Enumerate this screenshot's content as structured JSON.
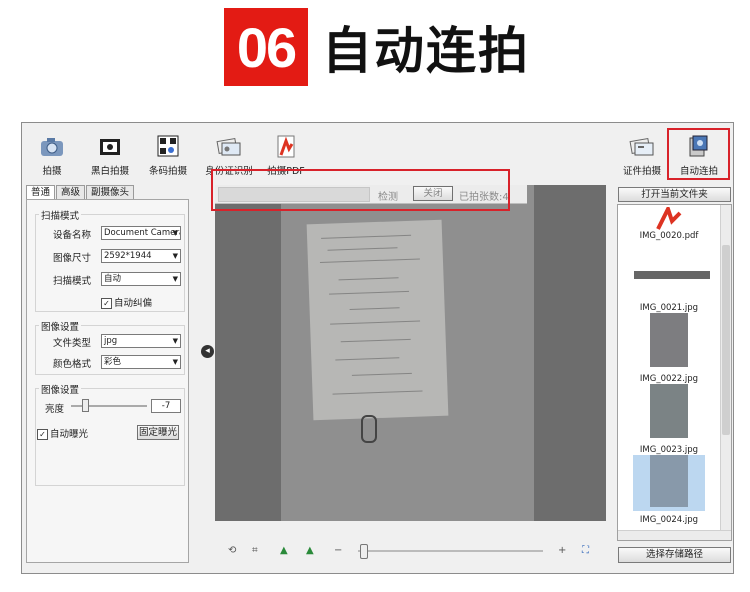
{
  "banner": {
    "number": "06",
    "title": "自动连拍"
  },
  "toolbar": {
    "items": [
      {
        "label": "拍摄",
        "icon": "camera-icon"
      },
      {
        "label": "黑白拍摄",
        "icon": "bw-photo-icon"
      },
      {
        "label": "条码拍摄",
        "icon": "barcode-icon"
      },
      {
        "label": "身份证识别",
        "icon": "id-card-icon"
      },
      {
        "label": "拍摄PDF",
        "icon": "pdf-icon"
      },
      {
        "label": "证件拍摄",
        "icon": "document-icon"
      },
      {
        "label": "自动连拍",
        "icon": "auto-shoot-icon"
      }
    ]
  },
  "tabs": [
    "普通",
    "高级",
    "副摄像头"
  ],
  "scan_mode": {
    "title": "扫描模式",
    "device_label": "设备名称",
    "device_value": "Document Camera",
    "size_label": "图像尺寸",
    "size_value": "2592*1944",
    "mode_label": "扫描模式",
    "mode_value": "自动",
    "auto_deskew": "自动纠偏"
  },
  "image_settings": {
    "title": "图像设置",
    "file_type_label": "文件类型",
    "file_type_value": "jpg",
    "color_label": "颜色格式",
    "color_value": "彩色"
  },
  "image_settings2": {
    "title": "图像设置",
    "brightness_label": "亮度",
    "brightness_value": "-7",
    "auto_exposure": "自动曝光",
    "fixed_exposure": "固定曝光"
  },
  "capture_bar": {
    "detect": "检测",
    "close": "关闭",
    "count": "已拍张数:4"
  },
  "right_panel": {
    "open_folder": "打开当前文件夹",
    "save_path": "选择存储路径",
    "files": [
      "IMG_0020.pdf",
      "IMG_0021.jpg",
      "IMG_0022.jpg",
      "IMG_0023.jpg",
      "IMG_0024.jpg"
    ]
  },
  "colors": {
    "badge": "#e31b14",
    "highlight": "#d8222a",
    "viewer_bg": "#6d6d6d"
  }
}
